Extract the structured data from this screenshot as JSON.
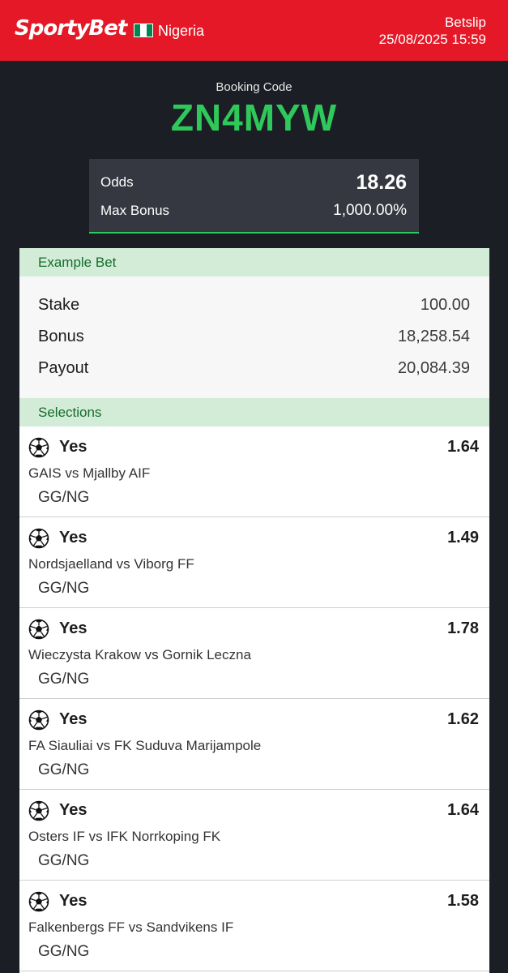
{
  "header": {
    "brand": "SportyBet",
    "country": "Nigeria",
    "flag_colors": [
      "#008751",
      "#ffffff",
      "#008751"
    ],
    "section": "Betslip",
    "datetime": "25/08/2025 15:59",
    "bg_color": "#e41827"
  },
  "booking": {
    "label": "Booking Code",
    "code": "ZN4MYW",
    "accent_color": "#2fc85a"
  },
  "summary": {
    "odds_label": "Odds",
    "odds_value": "18.26",
    "max_bonus_label": "Max Bonus",
    "max_bonus_value": "1,000.00%"
  },
  "example_bet": {
    "title": "Example Bet",
    "stake_label": "Stake",
    "stake_value": "100.00",
    "bonus_label": "Bonus",
    "bonus_value": "18,258.54",
    "payout_label": "Payout",
    "payout_value": "20,084.39"
  },
  "selections_title": "Selections",
  "selections": [
    {
      "icon": "soccer-ball-icon",
      "pick": "Yes",
      "odds": "1.64",
      "match": "GAIS vs Mjallby AIF",
      "market": "GG/NG"
    },
    {
      "icon": "soccer-ball-icon",
      "pick": "Yes",
      "odds": "1.49",
      "match": "Nordsjaelland vs Viborg FF",
      "market": "GG/NG"
    },
    {
      "icon": "soccer-ball-icon",
      "pick": "Yes",
      "odds": "1.78",
      "match": "Wieczysta Krakow vs Gornik Leczna",
      "market": "GG/NG"
    },
    {
      "icon": "soccer-ball-icon",
      "pick": "Yes",
      "odds": "1.62",
      "match": "FA Siauliai vs FK Suduva Marijampole",
      "market": "GG/NG"
    },
    {
      "icon": "soccer-ball-icon",
      "pick": "Yes",
      "odds": "1.64",
      "match": "Osters IF vs IFK Norrkoping FK",
      "market": "GG/NG"
    },
    {
      "icon": "soccer-ball-icon",
      "pick": "Yes",
      "odds": "1.58",
      "match": "Falkenbergs FF vs Sandvikens IF",
      "market": "GG/NG"
    }
  ]
}
